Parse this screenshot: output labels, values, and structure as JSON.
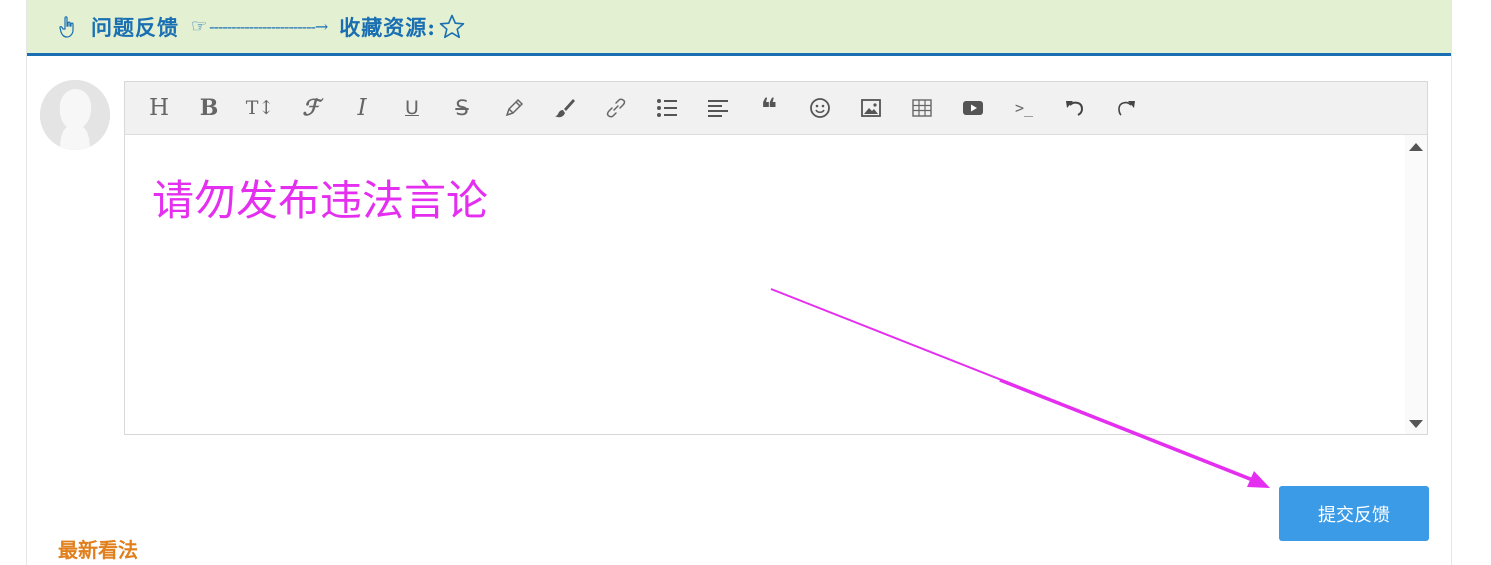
{
  "header": {
    "title": "问题反馈",
    "pointer_glyph": "☞",
    "dash_arrow": "------------------------→",
    "favorite_label": "收藏资源:",
    "color": "#1a6fb3",
    "background": "#e3f1d2"
  },
  "editor": {
    "toolbar": [
      {
        "name": "heading-icon",
        "glyph": "H"
      },
      {
        "name": "bold-icon",
        "glyph": "B"
      },
      {
        "name": "font-size-icon",
        "glyph": "T↕"
      },
      {
        "name": "font-family-icon",
        "glyph": "ℱ"
      },
      {
        "name": "italic-icon",
        "glyph": "I"
      },
      {
        "name": "underline-icon",
        "glyph": "U"
      },
      {
        "name": "strikethrough-icon",
        "glyph": "S"
      },
      {
        "name": "pen-icon",
        "glyph": "pen"
      },
      {
        "name": "brush-icon",
        "glyph": "brush"
      },
      {
        "name": "link-icon",
        "glyph": "link"
      },
      {
        "name": "bulleted-list-icon",
        "glyph": "list"
      },
      {
        "name": "align-icon",
        "glyph": "align"
      },
      {
        "name": "quote-icon",
        "glyph": "❝"
      },
      {
        "name": "emoji-icon",
        "glyph": "☺"
      },
      {
        "name": "image-icon",
        "glyph": "image"
      },
      {
        "name": "table-icon",
        "glyph": "table"
      },
      {
        "name": "video-icon",
        "glyph": "video"
      },
      {
        "name": "code-icon",
        "glyph": ">_"
      },
      {
        "name": "undo-icon",
        "glyph": "↶"
      },
      {
        "name": "redo-icon",
        "glyph": "↷"
      }
    ],
    "content": "请勿发布违法言论",
    "content_color": "#e52ff0"
  },
  "submit_button": {
    "label": "提交反馈",
    "color": "#3b9be6"
  },
  "latest_label": "最新看法",
  "accent_orange": "#e07f1c",
  "annotation_color": "#e52ff0"
}
